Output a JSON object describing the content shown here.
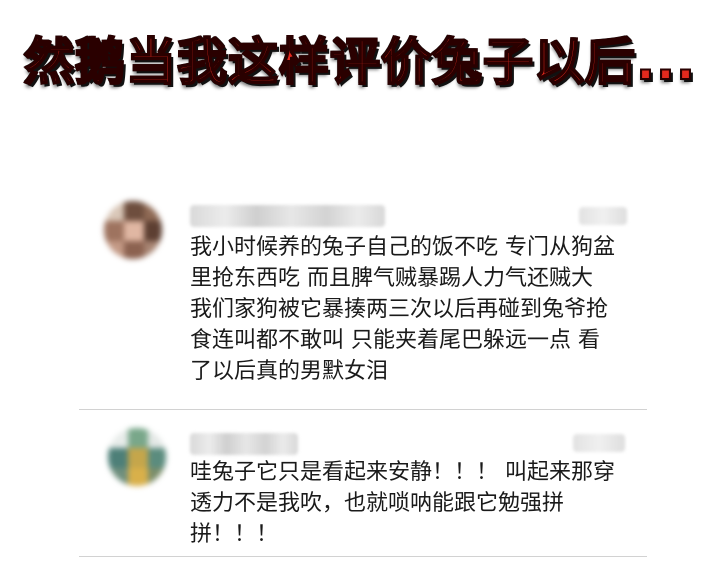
{
  "headline": "然鹅当我这样评价兔子以后...",
  "comments": [
    {
      "lines": [
        "我小时候养的兔子自己的饭不吃 专门从狗盆",
        "里抢东西吃 而且脾气贼暴踢人力气还贼大",
        "我们家狗被它暴揍两三次以后再碰到兔爷抢",
        "食连叫都不敢叫 只能夹着尾巴躲远一点 看",
        "了以后真的男默女泪"
      ]
    },
    {
      "lines": [
        "哇兔子它只是看起来安静！！！ 叫起来那穿",
        "透力不是我吹，也就唢呐能跟它勉强拼",
        "拼！！！"
      ]
    }
  ]
}
